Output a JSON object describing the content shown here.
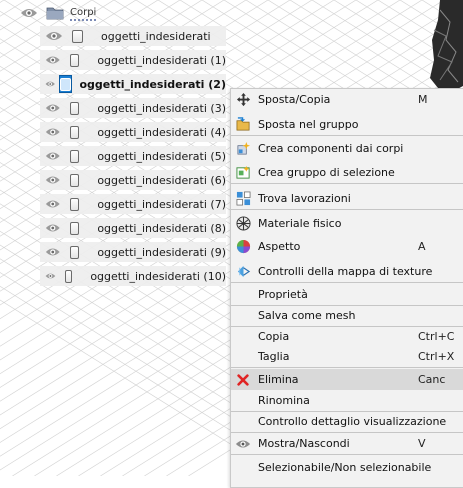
{
  "browser": {
    "folder": {
      "label": "Corpi",
      "icon": "folder-icon"
    },
    "items": [
      {
        "label": "oggetti_indesiderati"
      },
      {
        "label": "oggetti_indesiderati (1)"
      },
      {
        "label": "oggetti_indesiderati (2)",
        "selected": true
      },
      {
        "label": "oggetti_indesiderati (3)"
      },
      {
        "label": "oggetti_indesiderati (4)"
      },
      {
        "label": "oggetti_indesiderati (5)"
      },
      {
        "label": "oggetti_indesiderati (6)"
      },
      {
        "label": "oggetti_indesiderati (7)"
      },
      {
        "label": "oggetti_indesiderati (8)"
      },
      {
        "label": "oggetti_indesiderati (9)"
      },
      {
        "label": "oggetti_indesiderati (10)"
      }
    ]
  },
  "context_menu": {
    "items": [
      {
        "label": "Sposta/Copia",
        "shortcut": "M",
        "icon": "move-icon"
      },
      {
        "label": "Sposta nel gruppo",
        "icon": "move-to-group-icon"
      },
      {
        "label": "Crea componenti dai corpi",
        "icon": "create-components-icon"
      },
      {
        "label": "Crea gruppo di selezione",
        "icon": "selection-group-icon"
      },
      {
        "label": "Trova lavorazioni",
        "icon": "find-features-icon"
      },
      {
        "label": "Materiale fisico",
        "icon": "physical-material-icon"
      },
      {
        "label": "Aspetto",
        "shortcut": "A",
        "icon": "appearance-icon"
      },
      {
        "label": "Controlli della mappa di texture",
        "icon": "texture-map-icon"
      },
      {
        "label": "Proprietà"
      },
      {
        "label": "Salva come mesh"
      },
      {
        "label": "Copia",
        "shortcut": "Ctrl+C"
      },
      {
        "label": "Taglia",
        "shortcut": "Ctrl+X"
      },
      {
        "label": "Elimina",
        "shortcut": "Canc",
        "icon": "delete-icon",
        "highlighted": true
      },
      {
        "label": "Rinomina"
      },
      {
        "label": "Controllo dettaglio visualizzazione"
      },
      {
        "label": "Mostra/Nascondi",
        "shortcut": "V",
        "icon": "eye-icon"
      },
      {
        "label": "Selezionabile/Non selezionabile"
      }
    ]
  },
  "colors": {
    "selection": "#1b7fd3",
    "menu_background": "#f2f2f2",
    "menu_highlight": "#d9d9d9",
    "delete_red": "#e02424"
  }
}
